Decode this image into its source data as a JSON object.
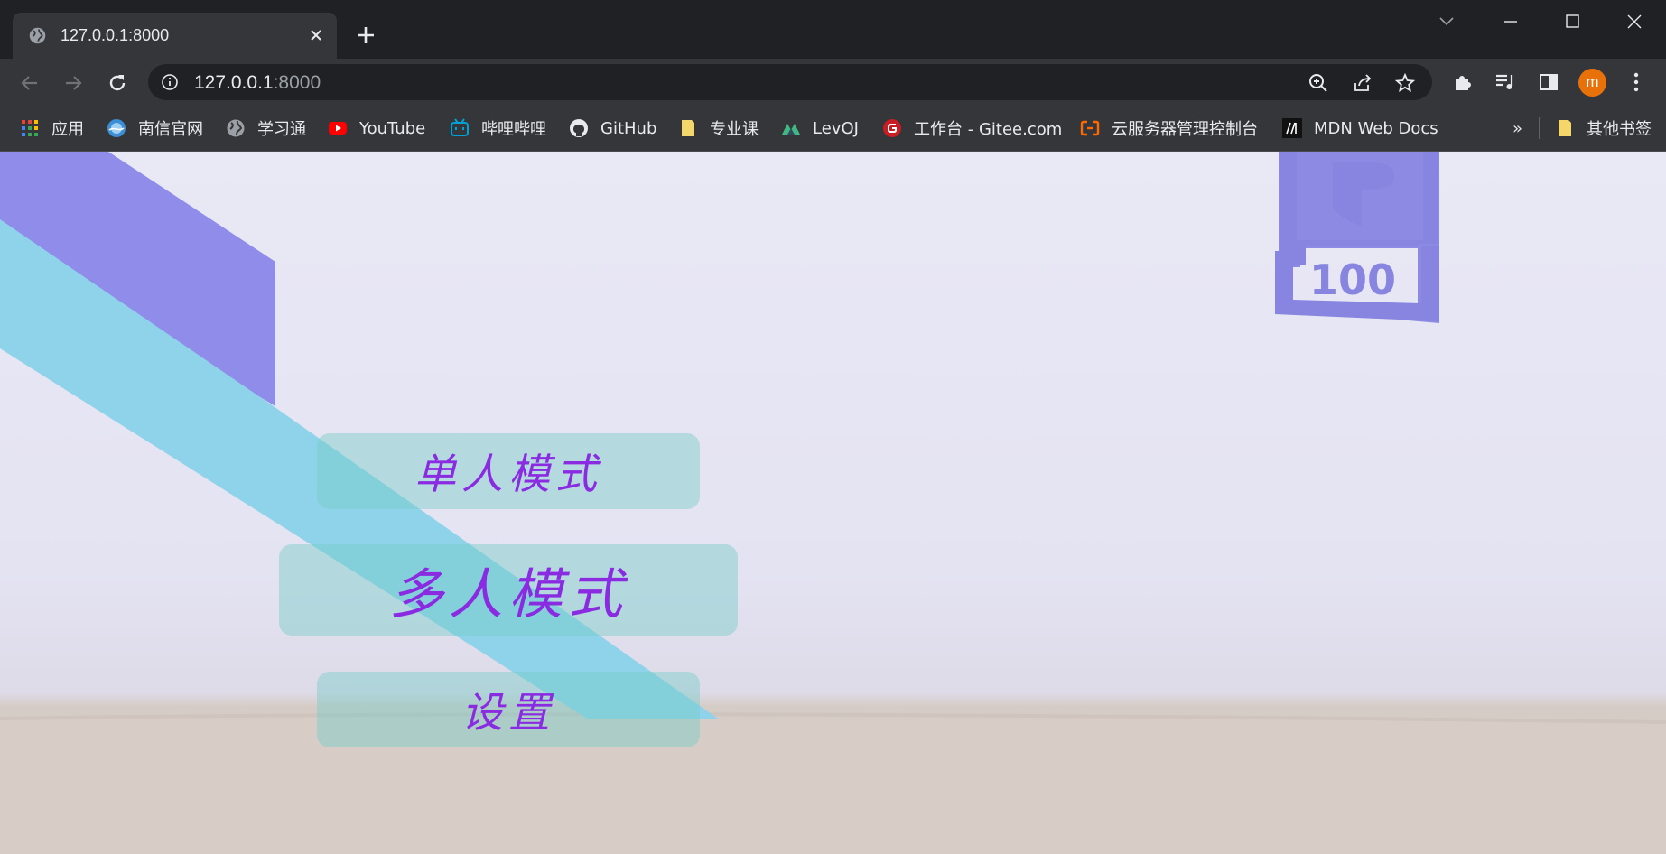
{
  "browser": {
    "tab": {
      "title": "127.0.0.1:8000"
    },
    "address_bar": {
      "host": "127.0.0.1",
      "port": ":8000"
    },
    "profile_initial": "m",
    "bookmarks": [
      {
        "label": "应用",
        "icon": "apps-grid-icon"
      },
      {
        "label": "南信官网",
        "icon": "nuist-logo-icon"
      },
      {
        "label": "学习通",
        "icon": "globe-icon"
      },
      {
        "label": "YouTube",
        "icon": "youtube-icon"
      },
      {
        "label": "哔哩哔哩",
        "icon": "bilibili-icon"
      },
      {
        "label": "GitHub",
        "icon": "github-icon"
      },
      {
        "label": "专业课",
        "icon": "folder-icon"
      },
      {
        "label": "LevOJ",
        "icon": "levoj-icon"
      },
      {
        "label": "工作台 - Gitee.com",
        "icon": "gitee-icon"
      },
      {
        "label": "云服务器管理控制台",
        "icon": "aliyun-icon"
      },
      {
        "label": "MDN Web Docs",
        "icon": "mdn-icon"
      }
    ],
    "overflow_label": "»",
    "other_bookmarks": {
      "label": "其他书签",
      "icon": "folder-icon"
    }
  },
  "page": {
    "menu": {
      "single_player": "单人模式",
      "multi_player": "多人模式",
      "settings": "设置"
    },
    "logo_text": "100",
    "colors": {
      "button_text": "#8a2be2",
      "button_bg": "rgba(120,205,200,0.45)",
      "purple_stripe": "#8f8cea",
      "cyan_stripe": "#8fd3ea"
    }
  }
}
